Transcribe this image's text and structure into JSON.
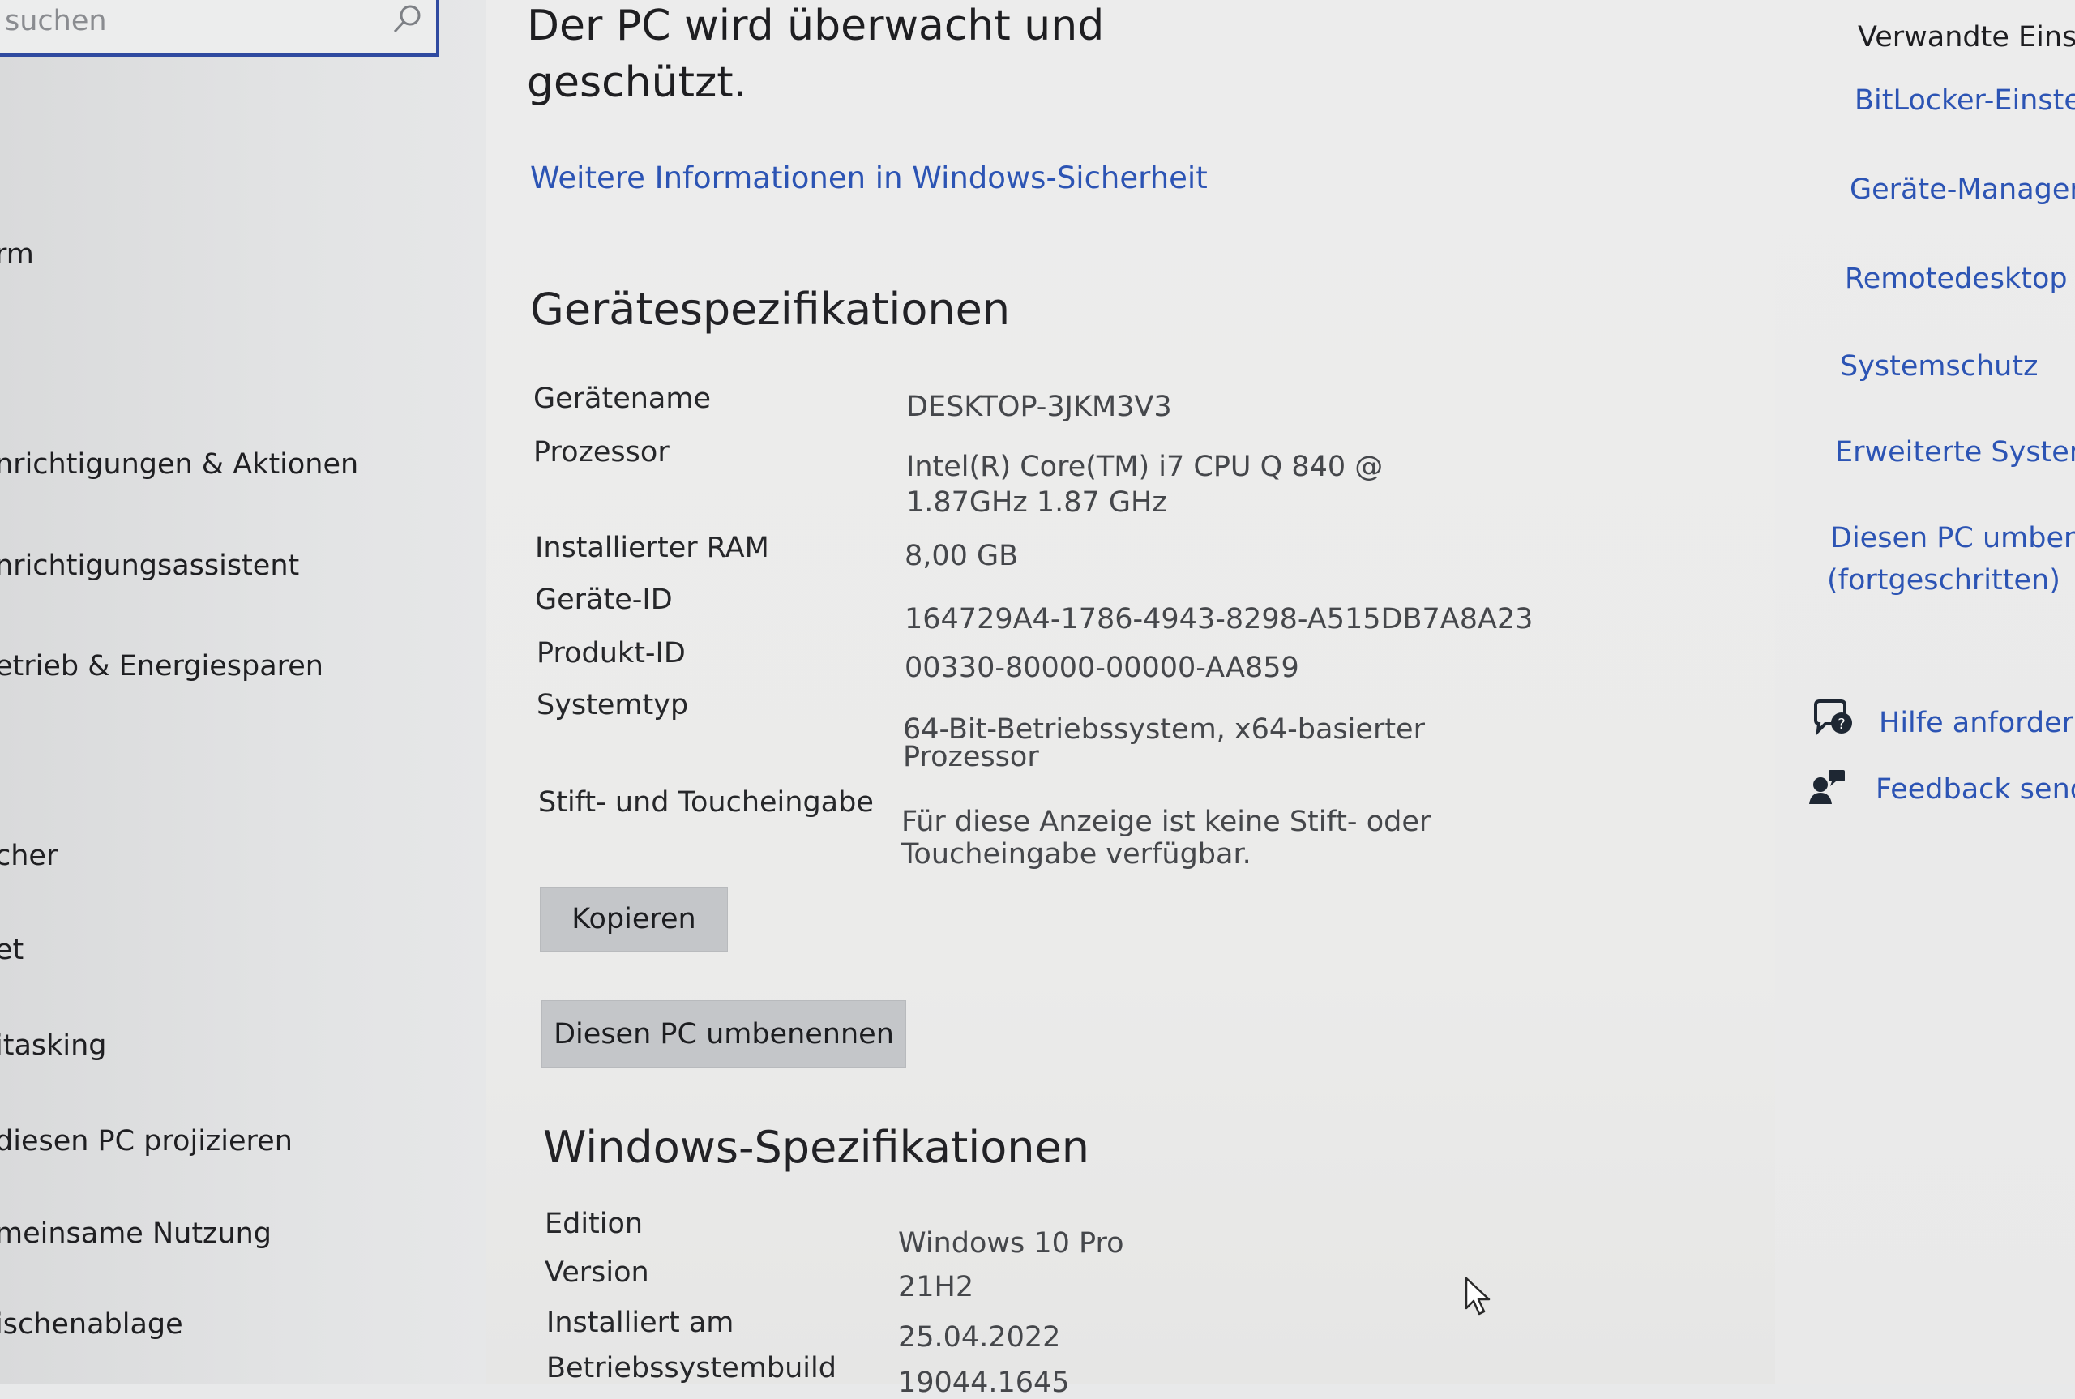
{
  "search": {
    "placeholder": "suchen"
  },
  "sidebar": {
    "items": [
      {
        "label": "rm"
      },
      {
        "label": "nrichtigungen & Aktionen"
      },
      {
        "label": "nrichtigungsassistent"
      },
      {
        "label": "etrieb & Energiesparen"
      },
      {
        "label": "cher"
      },
      {
        "label": "et"
      },
      {
        "label": "itasking"
      },
      {
        "label": "diesen PC projizieren"
      },
      {
        "label": "meinsame Nutzung"
      },
      {
        "label": "ischenablage"
      }
    ]
  },
  "security": {
    "heading_line1": "Der PC wird überwacht und",
    "heading_line2": "geschützt.",
    "link": "Weitere Informationen in Windows-Sicherheit"
  },
  "device_specs": {
    "title": "Gerätespezifikationen",
    "rows": [
      {
        "label": "Gerätename",
        "value": "DESKTOP-3JKM3V3"
      },
      {
        "label": "Prozessor",
        "value": "Intel(R) Core(TM) i7 CPU       Q 840  @",
        "value2": "1.87GHz   1.87 GHz"
      },
      {
        "label": "Installierter RAM",
        "value": "8,00 GB"
      },
      {
        "label": "Geräte-ID",
        "value": "164729A4-1786-4943-8298-A515DB7A8A23"
      },
      {
        "label": "Produkt-ID",
        "value": "00330-80000-00000-AA859"
      },
      {
        "label": "Systemtyp",
        "value": "64-Bit-Betriebssystem, x64-basierter",
        "value2": "Prozessor"
      },
      {
        "label": "Stift- und Toucheingabe",
        "value": "Für diese Anzeige ist keine Stift- oder",
        "value2": "Toucheingabe verfügbar."
      }
    ],
    "copy_button": "Kopieren",
    "rename_button": "Diesen PC umbenennen"
  },
  "windows_specs": {
    "title": "Windows-Spezifikationen",
    "rows": [
      {
        "label": "Edition",
        "value": "Windows 10 Pro"
      },
      {
        "label": "Version",
        "value": "21H2"
      },
      {
        "label": "Installiert am",
        "value": "25.04.2022"
      },
      {
        "label": "Betriebssystembuild",
        "value": "19044.1645"
      }
    ]
  },
  "related": {
    "title": "Verwandte Eins",
    "links": [
      {
        "label": "BitLocker-Einste"
      },
      {
        "label": "Geräte-Manager"
      },
      {
        "label": "Remotedesktop"
      },
      {
        "label": "Systemschutz"
      },
      {
        "label": "Erweiterte System"
      },
      {
        "label": "Diesen PC umbene",
        "label2": "(fortgeschritten)"
      }
    ],
    "help": "Hilfe anfordern",
    "feedback": "Feedback send"
  },
  "colors": {
    "link": "#2c54b4",
    "search_border": "#2f4aa0",
    "button": "#c4c6c9"
  }
}
